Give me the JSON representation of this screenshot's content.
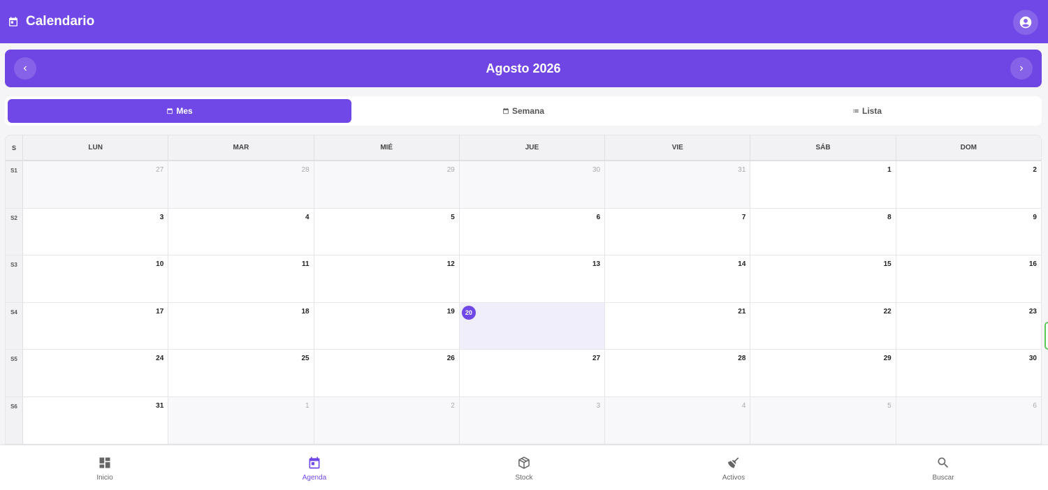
{
  "appbar": {
    "title": "Calendario",
    "title_icon": "calendar-icon",
    "account_icon": "account-circle-icon"
  },
  "month": {
    "title": "Agosto 2026",
    "prev_icon": "chevron-left-icon",
    "next_icon": "chevron-right-icon"
  },
  "views": [
    {
      "label": "Mes",
      "icon": "calendar-icon",
      "active": true
    },
    {
      "label": "Semana",
      "icon": "calendar-icon",
      "active": false
    },
    {
      "label": "Lista",
      "icon": "list-icon",
      "active": false
    }
  ],
  "calendar": {
    "week_header": "S",
    "weekdays": [
      "LUN",
      "MAR",
      "MIÉ",
      "JUE",
      "VIE",
      "SÁB",
      "DOM"
    ],
    "today": "20",
    "weeks": [
      {
        "label": "S1",
        "days": [
          {
            "n": "27",
            "o": true
          },
          {
            "n": "28",
            "o": true
          },
          {
            "n": "29",
            "o": true
          },
          {
            "n": "30",
            "o": true
          },
          {
            "n": "31",
            "o": true
          },
          {
            "n": "1",
            "o": false
          },
          {
            "n": "2",
            "o": false
          }
        ]
      },
      {
        "label": "S2",
        "days": [
          {
            "n": "3",
            "o": false
          },
          {
            "n": "4",
            "o": false
          },
          {
            "n": "5",
            "o": false
          },
          {
            "n": "6",
            "o": false
          },
          {
            "n": "7",
            "o": false
          },
          {
            "n": "8",
            "o": false
          },
          {
            "n": "9",
            "o": false
          }
        ]
      },
      {
        "label": "S3",
        "days": [
          {
            "n": "10",
            "o": false
          },
          {
            "n": "11",
            "o": false
          },
          {
            "n": "12",
            "o": false
          },
          {
            "n": "13",
            "o": false
          },
          {
            "n": "14",
            "o": false
          },
          {
            "n": "15",
            "o": false
          },
          {
            "n": "16",
            "o": false
          }
        ]
      },
      {
        "label": "S4",
        "days": [
          {
            "n": "17",
            "o": false
          },
          {
            "n": "18",
            "o": false
          },
          {
            "n": "19",
            "o": false
          },
          {
            "n": "20",
            "o": false,
            "today": true
          },
          {
            "n": "21",
            "o": false
          },
          {
            "n": "22",
            "o": false
          },
          {
            "n": "23",
            "o": false
          }
        ]
      },
      {
        "label": "S5",
        "days": [
          {
            "n": "24",
            "o": false
          },
          {
            "n": "25",
            "o": false
          },
          {
            "n": "26",
            "o": false
          },
          {
            "n": "27",
            "o": false
          },
          {
            "n": "28",
            "o": false
          },
          {
            "n": "29",
            "o": false
          },
          {
            "n": "30",
            "o": false
          }
        ]
      },
      {
        "label": "S6",
        "days": [
          {
            "n": "31",
            "o": false
          },
          {
            "n": "1",
            "o": true
          },
          {
            "n": "2",
            "o": true
          },
          {
            "n": "3",
            "o": true
          },
          {
            "n": "4",
            "o": true
          },
          {
            "n": "5",
            "o": true
          },
          {
            "n": "6",
            "o": true
          }
        ]
      }
    ]
  },
  "bottom_nav": [
    {
      "label": "Inicio",
      "icon": "dashboard-icon",
      "active": false
    },
    {
      "label": "Agenda",
      "icon": "calendar-icon",
      "active": true
    },
    {
      "label": "Stock",
      "icon": "box-icon",
      "active": false
    },
    {
      "label": "Activos",
      "icon": "broom-icon",
      "active": false
    },
    {
      "label": "Buscar",
      "icon": "search-icon",
      "active": false
    }
  ],
  "colors": {
    "primary": "#7048e8",
    "today_bg": "#f1eefb",
    "text": "#222222"
  }
}
